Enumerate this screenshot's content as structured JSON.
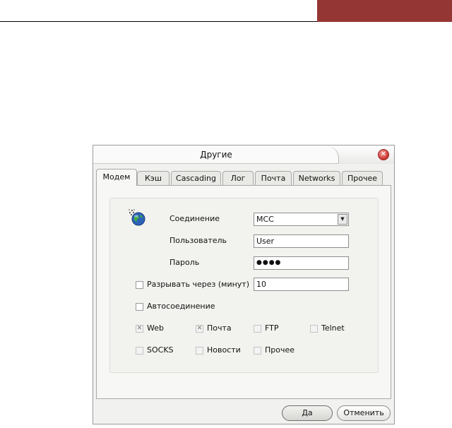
{
  "dialog": {
    "title": "Другие",
    "tabs": [
      "Модем",
      "Кэш",
      "Cascading",
      "Лог",
      "Почта",
      "Networks",
      "Прочее"
    ],
    "active_tab": "Модем",
    "modem": {
      "connection_label": "Соединение",
      "connection_value": "MCC",
      "user_label": "Пользователь",
      "user_value": "User",
      "password_label": "Пароль",
      "password_value": "●●●●",
      "disconnect_label": "Разрывать через (минут)",
      "disconnect_checked": false,
      "disconnect_value": "10",
      "autoconnect_label": "Автосоединение",
      "autoconnect_checked": false,
      "protocols": {
        "web": {
          "label": "Web",
          "checked": true,
          "enabled": false
        },
        "mail": {
          "label": "Почта",
          "checked": true,
          "enabled": false
        },
        "ftp": {
          "label": "FTP",
          "checked": false,
          "enabled": false
        },
        "telnet": {
          "label": "Telnet",
          "checked": false,
          "enabled": false
        },
        "socks": {
          "label": "SOCKS",
          "checked": false,
          "enabled": false
        },
        "news": {
          "label": "Новости",
          "checked": false,
          "enabled": false
        },
        "other": {
          "label": "Прочее",
          "checked": false,
          "enabled": false
        }
      }
    },
    "buttons": {
      "ok": "Да",
      "cancel": "Отменить"
    }
  },
  "colors": {
    "header_accent": "#943634",
    "close_button": "#c8322b"
  },
  "icons": {
    "connection": "globe-modem-icon",
    "close": "close-icon",
    "dropdown": "chevron-down-icon"
  }
}
